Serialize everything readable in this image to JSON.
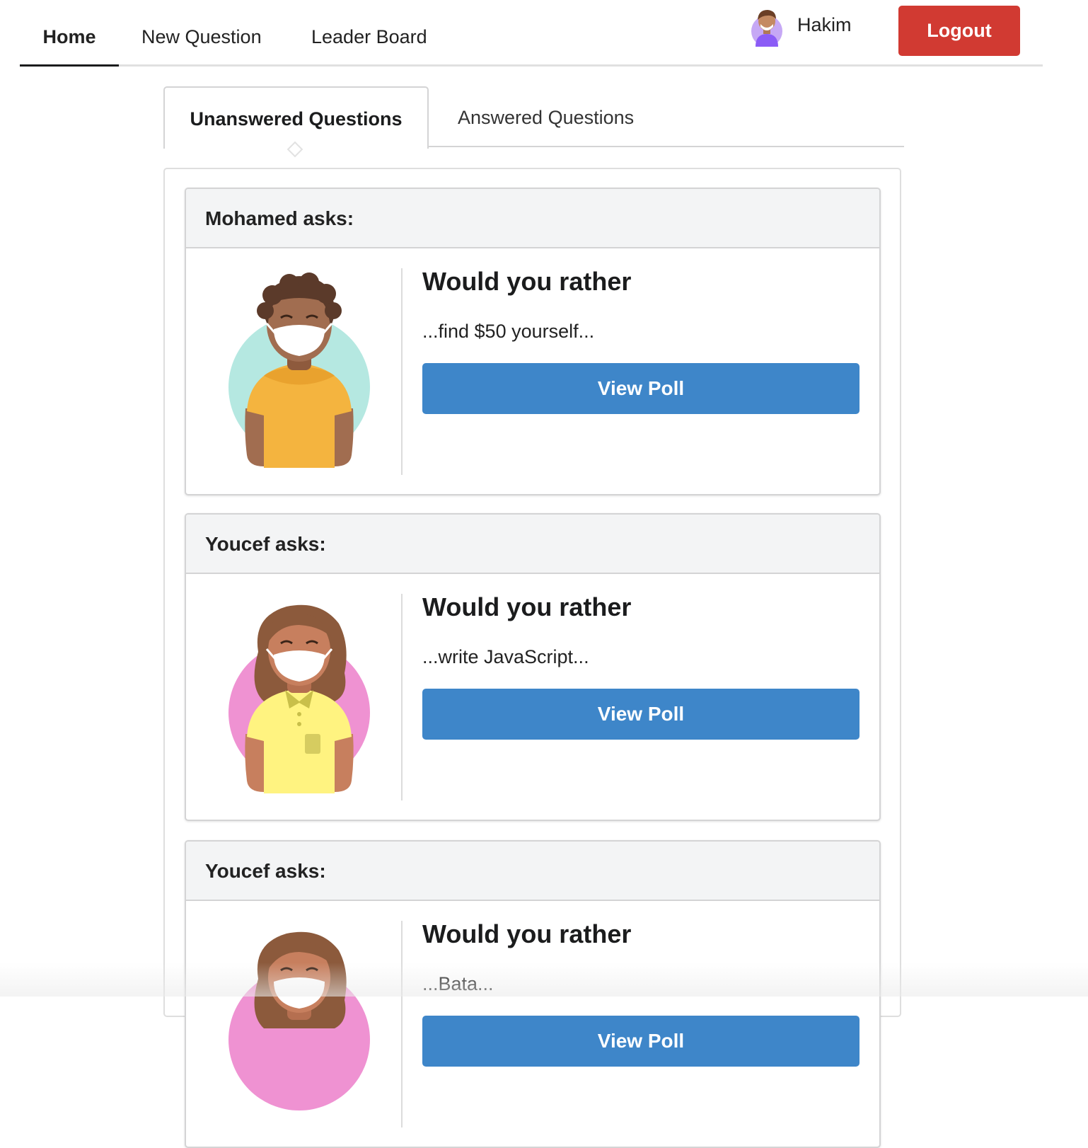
{
  "nav": {
    "home": "Home",
    "new_question": "New Question",
    "leader_board": "Leader Board",
    "user_name": "Hakim",
    "logout": "Logout"
  },
  "tabs": {
    "unanswered": "Unanswered Questions",
    "answered": "Answered Questions"
  },
  "questions": [
    {
      "header": "Mohamed asks:",
      "title": "Would you rather",
      "snippet": "...find $50 yourself...",
      "button": "View Poll",
      "avatar": "man-mask-avatar-icon"
    },
    {
      "header": "Youcef asks:",
      "title": "Would you rather",
      "snippet": "...write JavaScript...",
      "button": "View Poll",
      "avatar": "woman-mask-avatar-icon"
    },
    {
      "header": "Youcef asks:",
      "title": "Would you rather",
      "snippet": "...Bata...",
      "button": "View Poll",
      "avatar": "woman-mask-avatar-icon"
    }
  ],
  "colors": {
    "logout": "#d13a32",
    "view_poll": "#3e86c9",
    "card_header_bg": "#f3f4f5"
  }
}
